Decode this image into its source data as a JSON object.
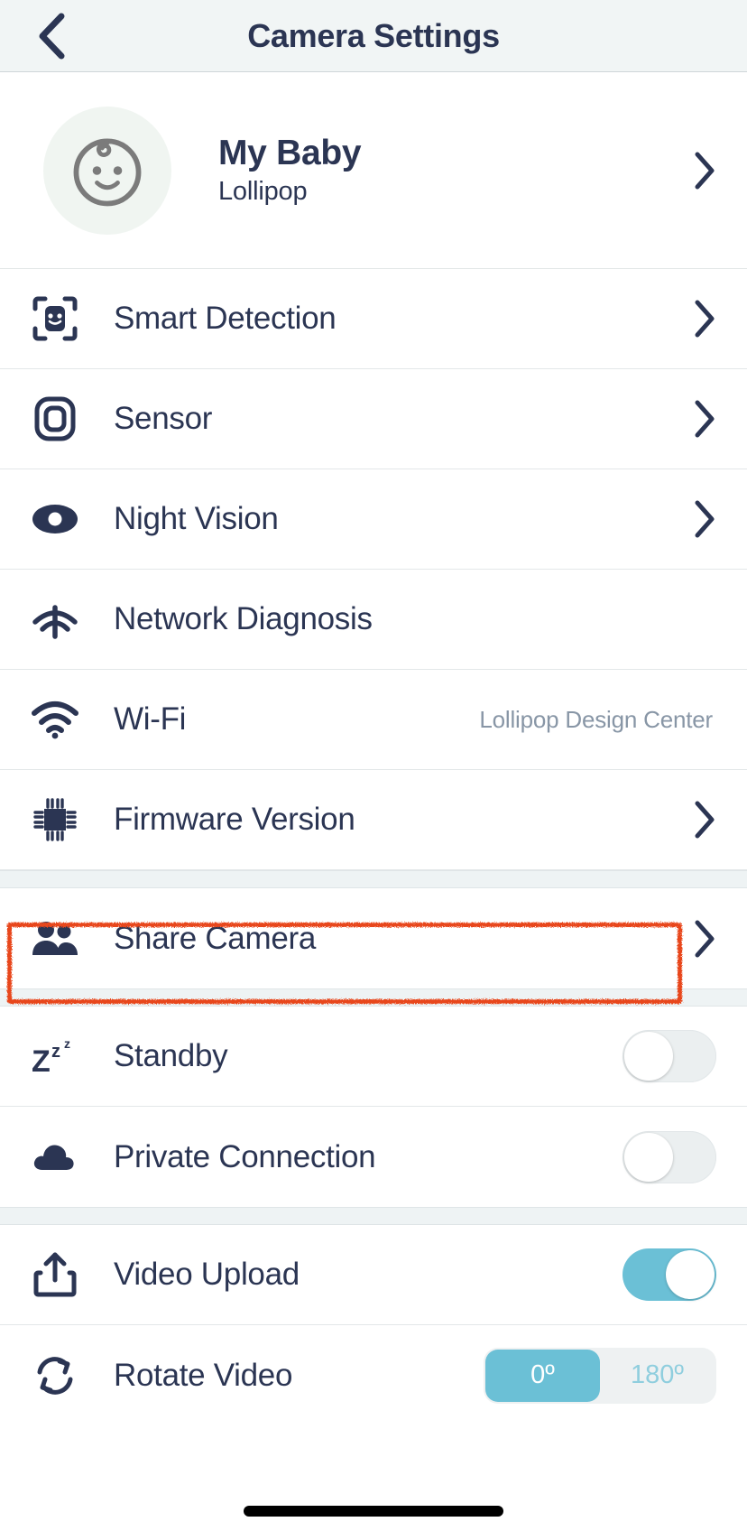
{
  "header": {
    "title": "Camera Settings",
    "back_icon": "chevron-left-icon"
  },
  "profile": {
    "name": "My Baby",
    "subtitle": "Lollipop",
    "avatar_icon": "baby-face-icon",
    "chevron": "chevron-right-icon"
  },
  "groups": [
    {
      "rows": [
        {
          "label": "Smart Detection",
          "icon": "face-scan-icon",
          "accessory": "chevron"
        },
        {
          "label": "Sensor",
          "icon": "sensor-rounded-square-icon",
          "accessory": "chevron"
        },
        {
          "label": "Night Vision",
          "icon": "eye-icon",
          "accessory": "chevron"
        },
        {
          "label": "Network Diagnosis",
          "icon": "network-signal-icon",
          "accessory": "none"
        },
        {
          "label": "Wi-Fi",
          "icon": "wifi-icon",
          "accessory": "value",
          "value": "Lollipop Design Center"
        },
        {
          "label": "Firmware Version",
          "icon": "chip-icon",
          "accessory": "chevron"
        }
      ]
    },
    {
      "rows": [
        {
          "label": "Share Camera",
          "icon": "people-group-icon",
          "accessory": "chevron"
        }
      ]
    },
    {
      "rows": [
        {
          "label": "Standby",
          "icon": "zzz-icon",
          "accessory": "toggle",
          "toggle_on": false
        },
        {
          "label": "Private Connection",
          "icon": "cloud-icon",
          "accessory": "toggle",
          "toggle_on": false
        }
      ]
    },
    {
      "rows": [
        {
          "label": "Video Upload",
          "icon": "upload-icon",
          "accessory": "toggle",
          "toggle_on": true
        },
        {
          "label": "Rotate Video",
          "icon": "rotate-icon",
          "accessory": "segmented",
          "options": [
            "0º",
            "180º"
          ],
          "selected_index": 0
        }
      ]
    }
  ],
  "annotation": {
    "target": "Share Camera",
    "color": "#e8471f"
  },
  "colors": {
    "text_primary": "#2b3553",
    "text_muted": "#8896a6",
    "accent": "#6bc0d6",
    "accent_light": "#8fcede",
    "header_bg": "#f1f5f5",
    "separator_bg": "#eef3f4",
    "avatar_bg": "#f0f5f1",
    "annotation": "#e8471f"
  }
}
